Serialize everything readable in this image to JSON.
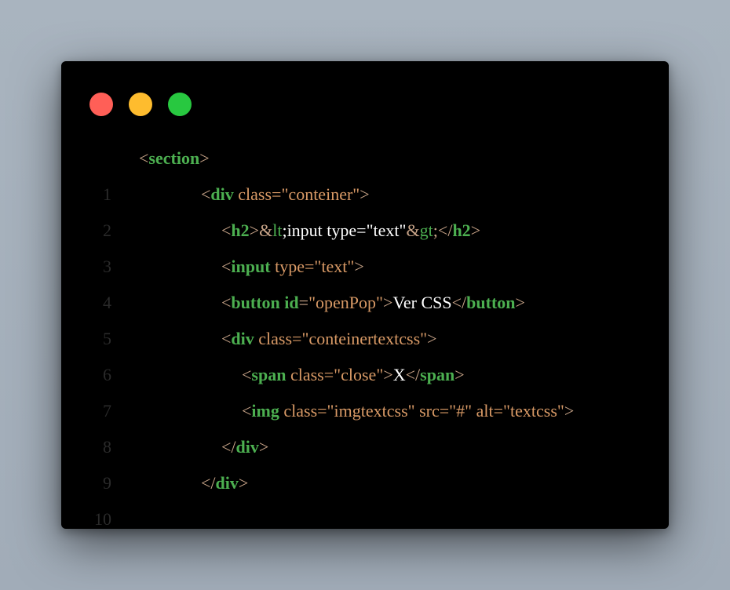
{
  "window_controls": {
    "close_color": "#ff5f57",
    "minimize_color": "#febc2e",
    "maximize_color": "#28c840"
  },
  "lines": [
    {
      "number": "1",
      "parts": [
        "<",
        "section",
        ">"
      ]
    },
    {
      "number": "2",
      "parts": [
        "<",
        "div",
        " class=",
        "\"conteiner\"",
        ">"
      ]
    },
    {
      "number": "3",
      "parts": [
        "<",
        "h2",
        ">",
        "&",
        "lt",
        ";input type=\"text\"",
        "&",
        "gt",
        ";",
        "</",
        "h2",
        ">"
      ]
    },
    {
      "number": "4",
      "parts": [
        "<",
        "input",
        " type=",
        "\"text\"",
        ">"
      ]
    },
    {
      "number": "5",
      "parts": [
        "<",
        "button",
        " ",
        "id",
        "=",
        "\"openPop\"",
        ">",
        "Ver CSS",
        "</",
        "button",
        ">"
      ]
    },
    {
      "number": "6",
      "parts": [
        "<",
        "div",
        " class=",
        "\"conteinertextcss\"",
        ">"
      ]
    },
    {
      "number": "7",
      "parts": [
        "<",
        "span",
        " class=",
        "\"close\"",
        ">",
        "X",
        "</",
        "span",
        ">"
      ]
    },
    {
      "number": "8",
      "parts": [
        "<",
        "img",
        " class=",
        "\"imgtextcss\"",
        " src=",
        "\"#\"",
        " alt=",
        "\"textcss\"",
        ">"
      ]
    },
    {
      "number": "9",
      "parts": [
        "</",
        "div",
        ">"
      ]
    },
    {
      "number": "10",
      "parts": [
        "</",
        "div",
        ">"
      ]
    }
  ]
}
